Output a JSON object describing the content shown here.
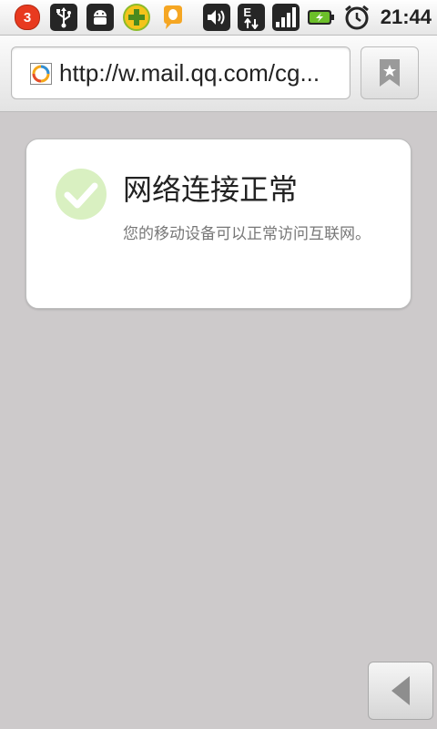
{
  "status_bar": {
    "notification_count": "3",
    "time": "21:44",
    "network_type": "E",
    "left_icons": [
      "notification-badge",
      "usb-icon",
      "android-debug-icon",
      "qihoo-360-icon",
      "qq-icon"
    ],
    "right_icons": [
      "volume-icon",
      "data-transfer-icon",
      "signal-icon",
      "battery-charging-icon",
      "alarm-clock-icon"
    ]
  },
  "browser": {
    "url": "http://w.mail.qq.com/cg...",
    "favicon": "qq-browser-favicon",
    "bookmark_icon": "bookmark-icon"
  },
  "card": {
    "title": "网络连接正常",
    "description": "您的移动设备可以正常访问互联网。",
    "icon": "check-circle-icon"
  },
  "navigation": {
    "back_icon": "back-arrow-icon"
  },
  "colors": {
    "background": "#cdcacb",
    "check_green": "#d9f0c1",
    "badge_red": "#e83a1f",
    "battery_green": "#6cbf2a"
  }
}
